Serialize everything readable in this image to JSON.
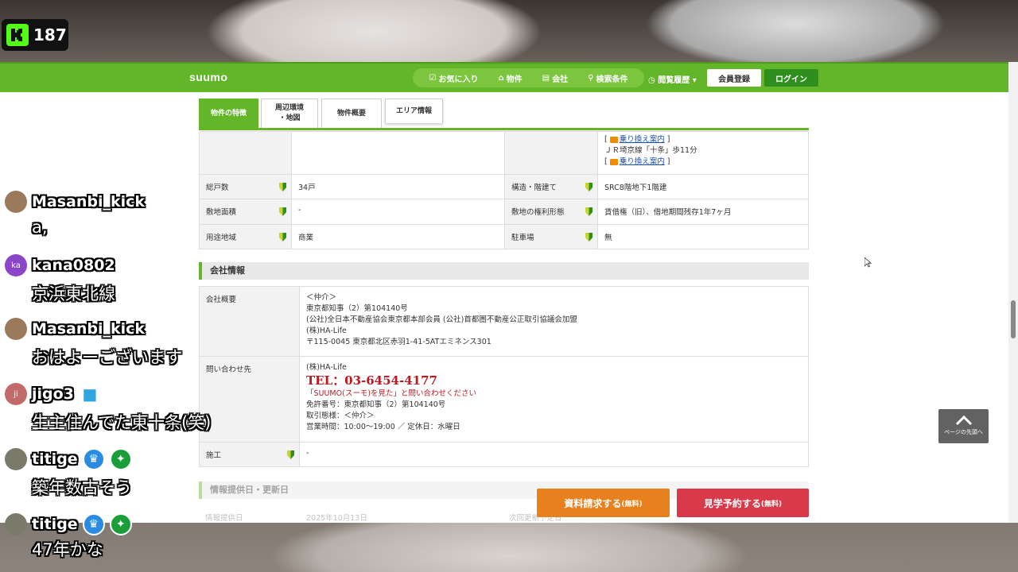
{
  "stream": {
    "viewer_count": "187"
  },
  "header": {
    "logo": "suumo",
    "nav": [
      "お気に入り",
      "物件",
      "会社",
      "検索条件"
    ],
    "history": "閲覧履歴",
    "register": "会員登録",
    "login": "ログイン"
  },
  "tabs": [
    {
      "label": "物件の特徴",
      "label2": ""
    },
    {
      "label": "周辺環境",
      "label2": "・地図"
    },
    {
      "label": "物件概要",
      "label2": ""
    },
    {
      "label": "エリア情報",
      "label2": ""
    }
  ],
  "property_rows": {
    "transfer_link_1": "乗り換え案内",
    "station_line": "ＪＲ埼京線「十条」歩11分",
    "transfer_link_2": "乗り換え案内",
    "total_units_label": "総戸数",
    "total_units": "34戸",
    "structure_label": "構造・階建て",
    "structure": "SRC8階地下1階建",
    "site_area_label": "敷地面積",
    "site_area": "-",
    "land_rights_label": "敷地の権利形態",
    "land_rights": "賃借権（旧）、借地期間残存1年7ヶ月",
    "zoning_label": "用途地域",
    "zoning": "商業",
    "parking_label": "駐車場",
    "parking": "無"
  },
  "company": {
    "section_title": "会社情報",
    "overview_label": "会社概要",
    "overview_lines": [
      "＜仲介＞",
      "東京都知事（2）第104140号",
      "(公社)全日本不動産協会東京都本部会員 (公社)首都圏不動産公正取引協議会加盟",
      "(株)HA-Life",
      "〒115-0045 東京都北区赤羽1-41-5ATエミネンス301"
    ],
    "contact_label": "問い合わせ先",
    "contact_name": "(株)HA-Life",
    "tel": "TEL：03-6454-4177",
    "tel_note": "「SUUMO(スーモ)を見た」と問い合わせください",
    "license": "免許番号：東京都知事（2）第104140号",
    "transaction": "取引態様：＜仲介＞",
    "hours": "営業時間：10:00～19:00 ／ 定休日：水曜日",
    "builder_label": "施工",
    "builder": "-"
  },
  "next_section": "情報提供日・更新日",
  "next_row": [
    "情報提供日",
    "2025年10月13日",
    "次回更新予定日"
  ],
  "cta": {
    "request_main": "資料請求する",
    "request_sub": "(無料)",
    "visit_main": "見学予約する",
    "visit_sub": "(無料)"
  },
  "page_top": "ページの先頭へ",
  "chat": [
    {
      "user": "Masanbi_kick",
      "text": "a,",
      "avatar": "",
      "avatar_color": "#9b7a5c",
      "badges": []
    },
    {
      "user": "kana0802",
      "text": "京浜東北線",
      "avatar": "ka",
      "avatar_color": "#8a45c9",
      "badges": []
    },
    {
      "user": "Masanbi_kick",
      "text": "おはよーございます",
      "avatar": "",
      "avatar_color": "#9b7a5c",
      "badges": []
    },
    {
      "user": "jigo3",
      "text": "生主住んでた東十条(笑)",
      "avatar": "ji",
      "avatar_color": "#c26a6a",
      "badges": [
        "cube"
      ]
    },
    {
      "user": "titige",
      "text": "築年数古そう",
      "avatar": "",
      "avatar_color": "#7a7a6a",
      "badges": [
        "crown",
        "star"
      ]
    },
    {
      "user": "titige",
      "text": "47年かな",
      "avatar": "",
      "avatar_color": "#7a7a6a",
      "badges": [
        "crown",
        "star"
      ]
    }
  ]
}
